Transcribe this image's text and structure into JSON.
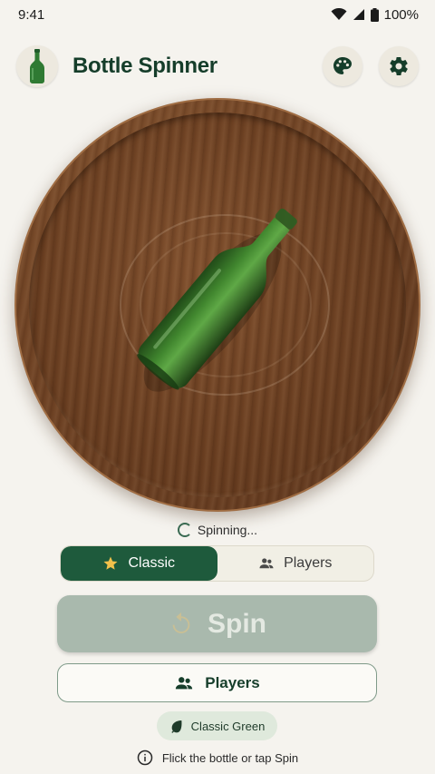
{
  "status_bar": {
    "time": "9:41",
    "battery": "100%"
  },
  "header": {
    "title": "Bottle Spinner"
  },
  "board": {
    "status_text": "Spinning..."
  },
  "mode_toggle": {
    "options": [
      {
        "label": "Classic",
        "icon": "star-icon",
        "active": true
      },
      {
        "label": "Players",
        "icon": "people-icon",
        "active": false
      }
    ]
  },
  "spin_button": {
    "label": "Spin"
  },
  "players_button": {
    "label": "Players"
  },
  "theme_chip": {
    "label": "Classic Green"
  },
  "hint": {
    "text": "Flick the bottle or tap Spin"
  },
  "colors": {
    "accent": "#1e5a3c",
    "background": "#f5f3ee",
    "spin_button_disabled": "#a9b9ad",
    "chip": "#dfe9dc"
  }
}
